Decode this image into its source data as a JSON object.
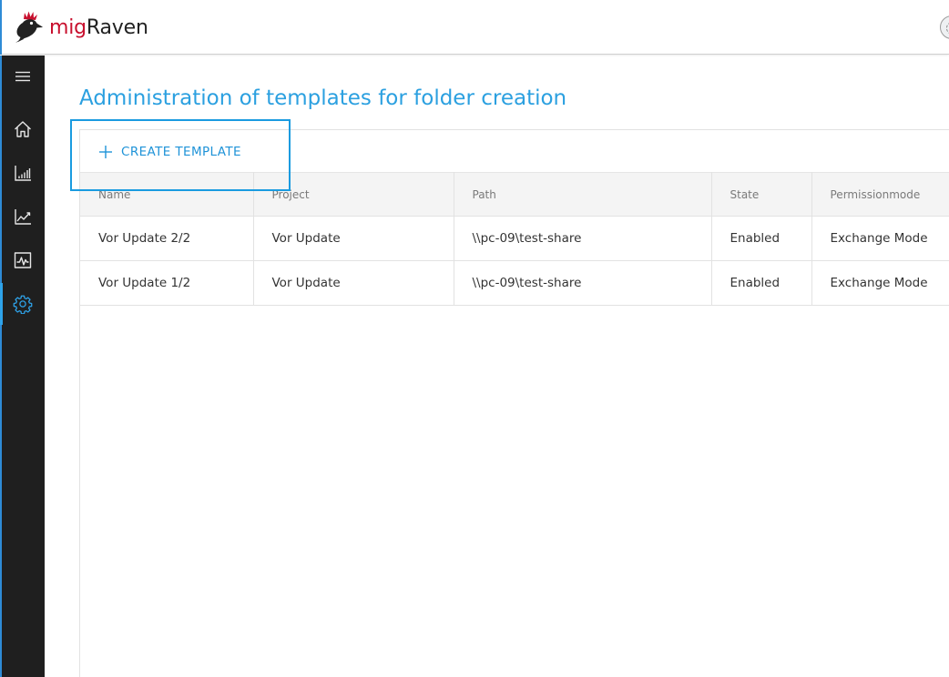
{
  "app": {
    "brand_prefix": "mig",
    "brand_suffix": "Raven",
    "brand_color": "#c8102e",
    "accent_color": "#2ba0e0"
  },
  "sidebar": {
    "items": [
      {
        "id": "menu",
        "icon": "hamburger-menu-icon",
        "active": false
      },
      {
        "id": "home",
        "icon": "home-icon",
        "active": false
      },
      {
        "id": "reports",
        "icon": "bar-chart-icon",
        "active": false
      },
      {
        "id": "analytics",
        "icon": "line-chart-icon",
        "active": false
      },
      {
        "id": "monitoring",
        "icon": "activity-monitor-icon",
        "active": false
      },
      {
        "id": "settings",
        "icon": "gear-icon",
        "active": true
      }
    ]
  },
  "page": {
    "title": "Administration of templates for folder creation",
    "create_button_label": "CREATE TEMPLATE"
  },
  "table": {
    "columns": [
      "Name",
      "Project",
      "Path",
      "State",
      "Permissionmode"
    ],
    "rows": [
      [
        "Vor Update 2/2",
        "Vor Update",
        "\\\\pc-09\\test-share",
        "Enabled",
        "Exchange Mode"
      ],
      [
        "Vor Update 1/2",
        "Vor Update",
        "\\\\pc-09\\test-share",
        "Enabled",
        "Exchange Mode"
      ]
    ]
  }
}
